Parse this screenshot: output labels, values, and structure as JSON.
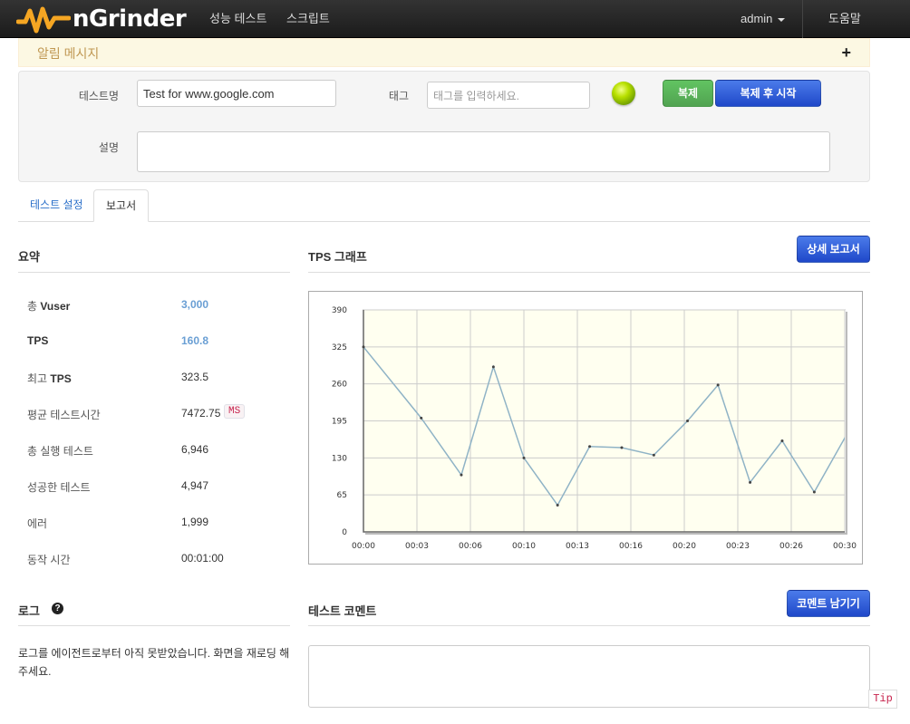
{
  "navbar": {
    "brand": "nGrinder",
    "menu": [
      "성능 테스트",
      "스크립트"
    ],
    "user": "admin",
    "help": "도움말"
  },
  "alert": {
    "title": "알림 메시지",
    "toggle": "+"
  },
  "form": {
    "test_name_label": "테스트명",
    "test_name_value": "Test for www.google.com",
    "tag_label": "태그",
    "tag_placeholder": "태그를 입력하세요.",
    "description_label": "설명",
    "clone_button": "복제",
    "clone_start_button": "복제 후 시작"
  },
  "tabs": [
    {
      "label": "테스트 설정",
      "active": false
    },
    {
      "label": "보고서",
      "active": true
    }
  ],
  "summary": {
    "title": "요약",
    "rows": [
      {
        "prefix": "총 ",
        "bold": "Vuser",
        "value": "3,000",
        "link": true
      },
      {
        "prefix": "",
        "bold": "TPS",
        "value": "160.8",
        "link": true
      },
      {
        "prefix": "최고 ",
        "bold": "TPS",
        "value": "323.5",
        "link": false
      },
      {
        "prefix": "평균 테스트시간",
        "bold": "",
        "value": "7472.75",
        "unit": "MS",
        "link": false
      },
      {
        "prefix": "총 실행 테스트",
        "bold": "",
        "value": "6,946",
        "link": false
      },
      {
        "prefix": "성공한 테스트",
        "bold": "",
        "value": "4,947",
        "link": false
      },
      {
        "prefix": "에러",
        "bold": "",
        "value": "1,999",
        "link": false
      },
      {
        "prefix": "동작 시간",
        "bold": "",
        "value": "00:01:00",
        "link": false
      }
    ]
  },
  "tps_section": {
    "title": "TPS 그래프",
    "detail_button": "상세 보고서"
  },
  "chart_data": {
    "type": "line",
    "title": "",
    "xlabel": "",
    "ylabel": "",
    "ylim": [
      0,
      390
    ],
    "yticks": [
      0,
      65,
      130,
      195,
      260,
      325,
      390
    ],
    "xticks": [
      "00:00",
      "00:03",
      "00:06",
      "00:10",
      "00:13",
      "00:16",
      "00:20",
      "00:23",
      "00:26",
      "00:30"
    ],
    "xlim": [
      0,
      30
    ],
    "grid": true,
    "colors": {
      "line": "#8fb3c6",
      "plot_bg": "#fffff0",
      "grid": "#cccccc"
    },
    "series": [
      {
        "x": [
          0,
          3.6,
          6.1,
          8.1,
          10,
          12.1,
          14.1,
          16.1,
          18.1,
          20.2,
          22.1,
          24.1,
          26.1,
          28.1,
          30.2
        ],
        "values": [
          325,
          200,
          100,
          290,
          130,
          47,
          150,
          148,
          135,
          195,
          258,
          87,
          160,
          70,
          175
        ]
      }
    ]
  },
  "log_section": {
    "title": "로그",
    "message": "로그를 에이전트로부터 아직 못받았습니다. 화면을 재로딩 해주세요."
  },
  "comment_section": {
    "title": "테스트 코멘트",
    "button": "코멘트 남기기"
  },
  "tip": "Tip"
}
